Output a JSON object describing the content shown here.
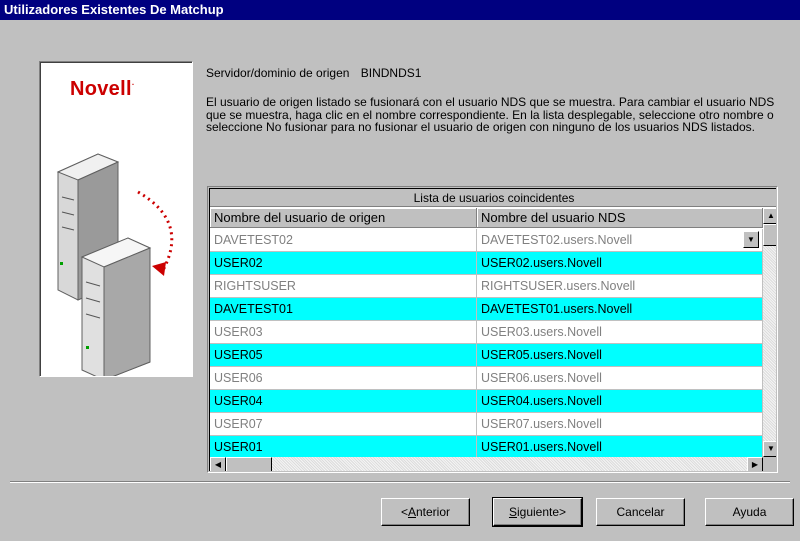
{
  "window": {
    "title": "Utilizadores Existentes De Matchup"
  },
  "branding": {
    "logo_text": "Novell",
    "logo_color": "#cc0000"
  },
  "server": {
    "label": "Servidor/dominio de origen",
    "value": "BINDNDS1"
  },
  "description": "El usuario de origen listado se fusionará con el usuario NDS que se muestra. Para cambiar el usuario NDS que se muestra, haga clic en el nombre correspondiente. En la lista desplegable, seleccione otro nombre o seleccione No fusionar para no fusionar el usuario de origen con ninguno de los usuarios NDS listados.",
  "grid": {
    "caption": "Lista de usuarios coincidentes",
    "columns": [
      "Nombre del usuario de origen",
      "Nombre del usuario NDS"
    ],
    "rows": [
      {
        "source": "DAVETEST02",
        "nds": "DAVETEST02.users.Novell",
        "highlighted": false
      },
      {
        "source": "USER02",
        "nds": "USER02.users.Novell",
        "highlighted": true
      },
      {
        "source": "RIGHTSUSER",
        "nds": "RIGHTSUSER.users.Novell",
        "highlighted": false
      },
      {
        "source": "DAVETEST01",
        "nds": "DAVETEST01.users.Novell",
        "highlighted": true
      },
      {
        "source": "USER03",
        "nds": "USER03.users.Novell",
        "highlighted": false
      },
      {
        "source": "USER05",
        "nds": "USER05.users.Novell",
        "highlighted": true
      },
      {
        "source": "USER06",
        "nds": "USER06.users.Novell",
        "highlighted": false
      },
      {
        "source": "USER04",
        "nds": "USER04.users.Novell",
        "highlighted": true
      },
      {
        "source": "USER07",
        "nds": "USER07.users.Novell",
        "highlighted": false
      },
      {
        "source": "USER01",
        "nds": "USER01.users.Novell",
        "highlighted": true
      }
    ],
    "highlight_color": "#00ffff"
  },
  "buttons": {
    "back": {
      "prefix": "<",
      "underlined": "A",
      "rest": "nterior"
    },
    "next": {
      "underlined": "S",
      "rest": "iguiente>"
    },
    "cancel": "Cancelar",
    "help": "Ayuda"
  }
}
